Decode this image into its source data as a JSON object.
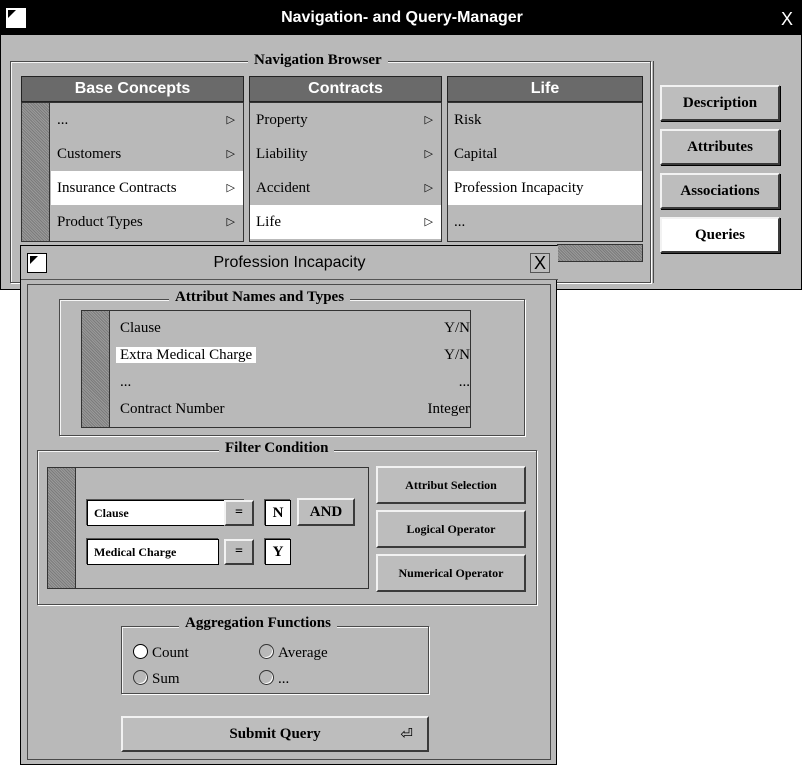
{
  "main_window": {
    "title": "Navigation- and Query-Manager",
    "close_glyph": "X",
    "navigation_browser": {
      "label": "Navigation Browser",
      "columns": [
        {
          "header": "Base Concepts",
          "items": [
            {
              "label": "...",
              "selected": false,
              "has_submenu": true
            },
            {
              "label": "Customers",
              "selected": false,
              "has_submenu": true
            },
            {
              "label": "Insurance Contracts",
              "selected": true,
              "has_submenu": true
            },
            {
              "label": "Product Types",
              "selected": false,
              "has_submenu": true
            }
          ]
        },
        {
          "header": "Contracts",
          "items": [
            {
              "label": "Property",
              "selected": false,
              "has_submenu": true
            },
            {
              "label": "Liability",
              "selected": false,
              "has_submenu": true
            },
            {
              "label": "Accident",
              "selected": false,
              "has_submenu": true
            },
            {
              "label": "Life",
              "selected": true,
              "has_submenu": true
            }
          ]
        },
        {
          "header": "Life",
          "items": [
            {
              "label": "Risk",
              "selected": false,
              "has_submenu": false
            },
            {
              "label": "Capital",
              "selected": false,
              "has_submenu": false
            },
            {
              "label": "Profession Incapacity",
              "selected": true,
              "has_submenu": false
            },
            {
              "label": "...",
              "selected": false,
              "has_submenu": false
            }
          ]
        }
      ],
      "submenu_glyph": "▷"
    },
    "side_buttons": {
      "description": "Description",
      "attributes": "Attributes",
      "associations": "Associations",
      "queries": "Queries",
      "active": "queries"
    }
  },
  "dialog": {
    "title": "Profession Incapacity",
    "close_glyph": "X",
    "attributes_group": {
      "label": "Attribut Names and Types",
      "rows": [
        {
          "name": "Clause",
          "type": "Y/N",
          "selected": false
        },
        {
          "name": "Extra Medical Charge",
          "type": "Y/N",
          "selected": true
        },
        {
          "name": "...",
          "type": "...",
          "selected": false
        },
        {
          "name": "Contract Number",
          "type": "Integer",
          "selected": false
        }
      ]
    },
    "filter_group": {
      "label": "Filter Condition",
      "condition_1": {
        "field": "Clause",
        "operator": "=",
        "value": "N",
        "connector": "AND"
      },
      "condition_2": {
        "field": "Medical Charge",
        "operator": "=",
        "value": "Y"
      },
      "buttons": {
        "attribut_selection": "Attribut Selection",
        "logical_operator": "Logical Operator",
        "numerical_operator": "Numerical Operator"
      }
    },
    "aggregation_group": {
      "label": "Aggregation Functions",
      "options": {
        "count": "Count",
        "average": "Average",
        "sum": "Sum",
        "other": "..."
      },
      "selected": "count"
    },
    "submit": {
      "label": "Submit Query",
      "glyph": "⏎"
    }
  },
  "colors": {
    "window_gray": "#b9b9b9",
    "header_gray": "#6a6a6a",
    "title_black": "#000000",
    "selection_white": "#ffffff"
  }
}
